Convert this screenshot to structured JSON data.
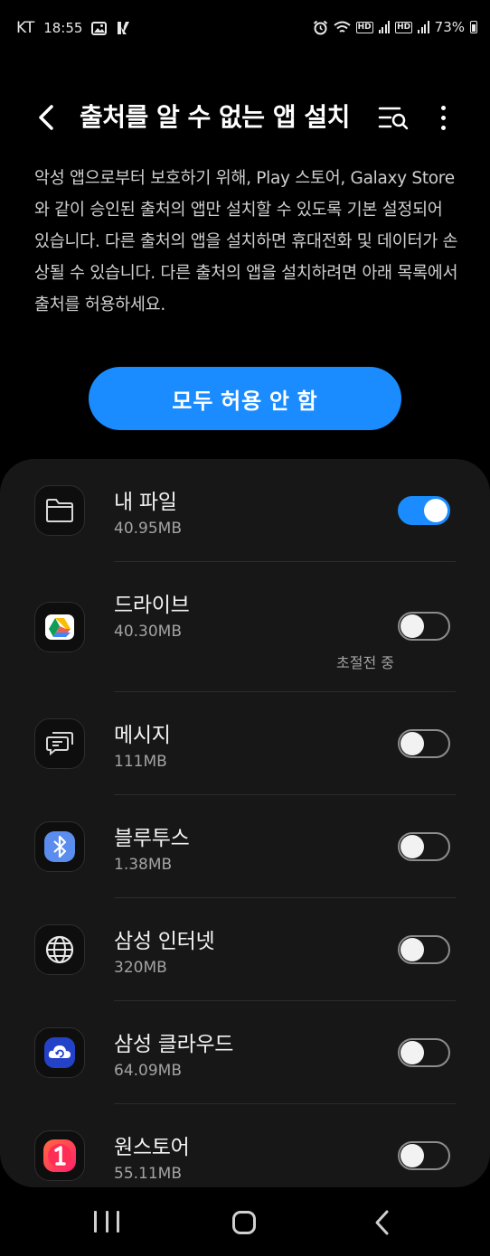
{
  "status_bar": {
    "carrier": "KT",
    "time": "18:55",
    "hd1": "HD",
    "hd2": "HD",
    "battery": "73%"
  },
  "header": {
    "title": "출처를 알 수 없는 앱 설치"
  },
  "description": "악성 앱으로부터 보호하기 위해, Play 스토어, Galaxy Store와 같이 승인된 출처의 앱만 설치할 수 있도록 기본 설정되어 있습니다. 다른 출처의 앱을 설치하면 휴대전화 및 데이터가 손상될 수 있습니다. 다른 출처의 앱을 설치하려면 아래 목록에서 출처를 허용하세요.",
  "allow_all_label": "모두 허용 안 함",
  "apps": [
    {
      "name": "내 파일",
      "size": "40.95MB",
      "note": "",
      "enabled": true,
      "icon": "folder-icon"
    },
    {
      "name": "드라이브",
      "size": "40.30MB",
      "note": "초절전 중",
      "enabled": false,
      "icon": "google-drive-icon"
    },
    {
      "name": "메시지",
      "size": "111MB",
      "note": "",
      "enabled": false,
      "icon": "messages-icon"
    },
    {
      "name": "블루투스",
      "size": "1.38MB",
      "note": "",
      "enabled": false,
      "icon": "bluetooth-icon"
    },
    {
      "name": "삼성 인터넷",
      "size": "320MB",
      "note": "",
      "enabled": false,
      "icon": "globe-icon"
    },
    {
      "name": "삼성 클라우드",
      "size": "64.09MB",
      "note": "",
      "enabled": false,
      "icon": "cloud-icon"
    },
    {
      "name": "원스토어",
      "size": "55.11MB",
      "note": "",
      "enabled": false,
      "icon": "onestore-icon"
    }
  ],
  "colors": {
    "accent": "#1a8cff",
    "background": "#000000",
    "card": "#171717"
  }
}
